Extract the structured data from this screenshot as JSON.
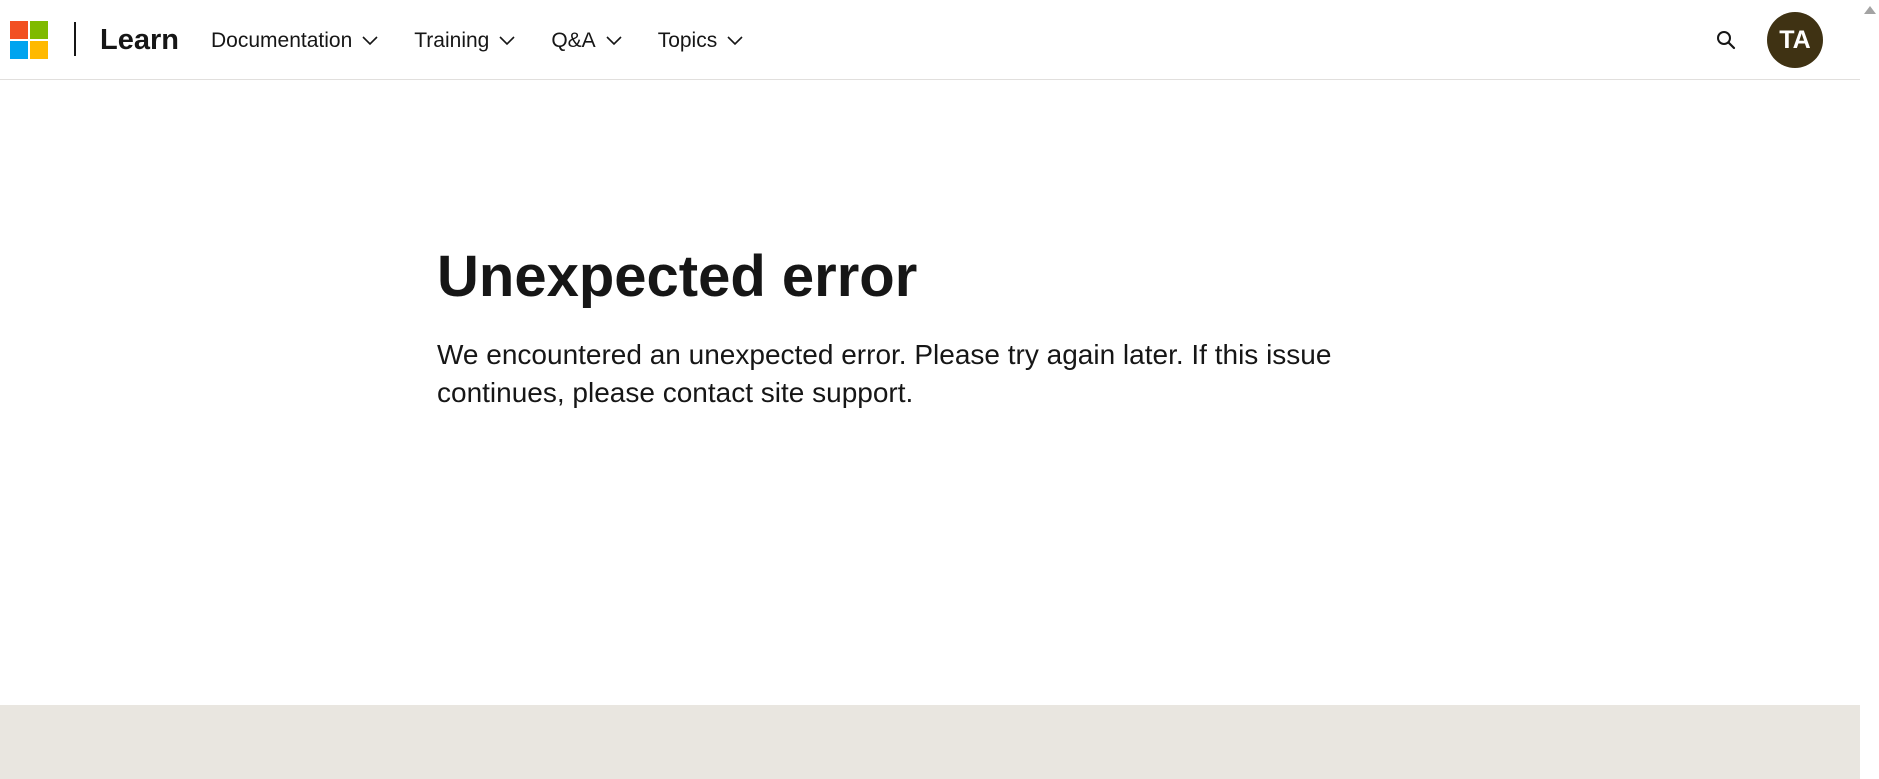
{
  "header": {
    "brand": "Learn",
    "logo_colors": [
      "#f25022",
      "#7fba00",
      "#00a4ef",
      "#ffb900"
    ],
    "nav": [
      {
        "label": "Documentation"
      },
      {
        "label": "Training"
      },
      {
        "label": "Q&A"
      },
      {
        "label": "Topics"
      }
    ],
    "search_icon": "search-icon",
    "avatar_initials": "TA",
    "avatar_color": "#3f3213"
  },
  "main": {
    "title": "Unexpected error",
    "message": "We encountered an unexpected error. Please try again later. If this issue continues, please contact site support."
  },
  "colors": {
    "footer_band": "#e9e6e0",
    "text": "#161616"
  }
}
